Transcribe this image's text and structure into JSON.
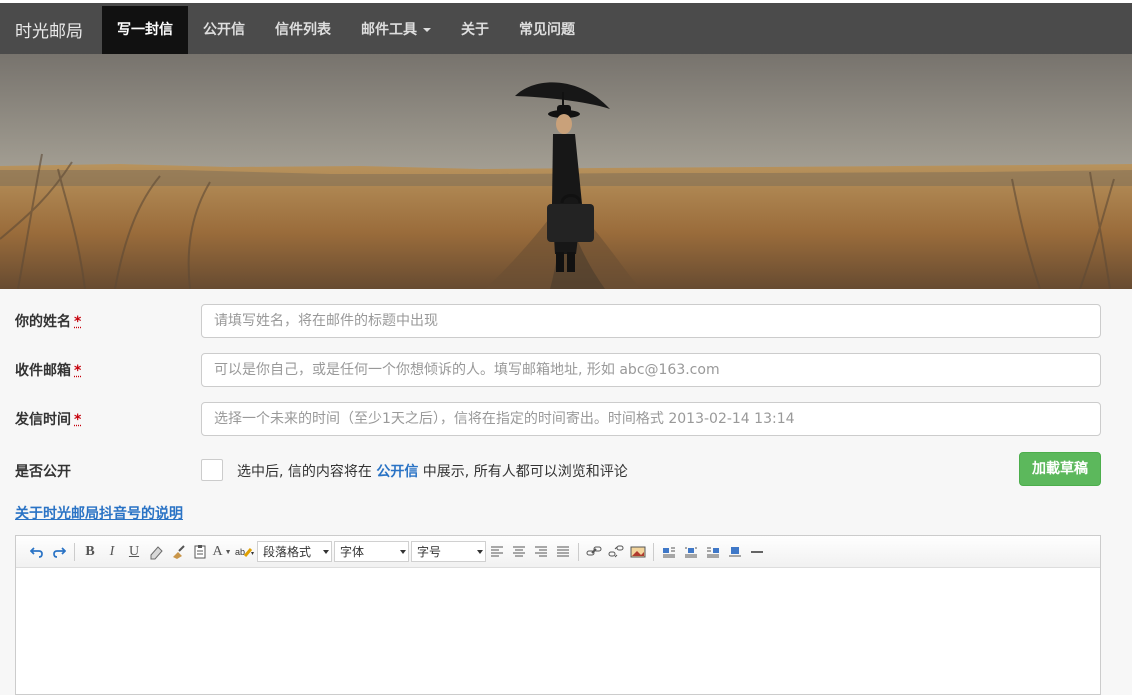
{
  "header": {
    "brand": "时光邮局",
    "nav": [
      {
        "label": "写一封信",
        "active": true
      },
      {
        "label": "公开信",
        "active": false
      },
      {
        "label": "信件列表",
        "active": false
      },
      {
        "label": "邮件工具",
        "active": false,
        "dropdown": true
      },
      {
        "label": "关于",
        "active": false
      },
      {
        "label": "常见问题",
        "active": false
      }
    ]
  },
  "form": {
    "name": {
      "label": "你的姓名",
      "required_mark": "*",
      "placeholder": "请填写姓名，将在邮件的标题中出现"
    },
    "email": {
      "label": "收件邮箱",
      "required_mark": "*",
      "placeholder": "可以是你自己，或是任何一个你想倾诉的人。填写邮箱地址, 形如 abc@163.com"
    },
    "time": {
      "label": "发信时间",
      "required_mark": "*",
      "placeholder": "选择一个未来的时间（至少1天之后），信将在指定的时间寄出。时间格式 2013-02-14 13:14"
    },
    "public": {
      "label": "是否公开",
      "checked": false,
      "note_before": "选中后, 信的内容将在 ",
      "note_link": "公开信",
      "note_after": " 中展示, 所有人都可以浏览和评论"
    },
    "draft_button": "加載草稿"
  },
  "douyin_link": "关于时光邮局抖音号的说明",
  "editor": {
    "paragraph_format": "段落格式",
    "font": "字体",
    "font_size": "字号",
    "content": ""
  },
  "colors": {
    "header_bg": "#4b4b4b",
    "active_nav_bg": "#111111",
    "link": "#2a73c5",
    "draft_button": "#5cb85c",
    "required": "#c6000b"
  },
  "icons": [
    "undo-icon",
    "redo-icon",
    "bold-icon",
    "italic-icon",
    "underline-icon",
    "eraser-icon",
    "format-brush-icon",
    "paste-text-icon",
    "font-color-icon",
    "highlight-icon",
    "align-left-icon",
    "align-center-icon",
    "align-right-icon",
    "justify-icon",
    "link-icon",
    "unlink-icon",
    "image-icon",
    "image-left-icon",
    "image-center-icon",
    "image-right-icon",
    "image-block-icon",
    "horizontal-rule-icon"
  ]
}
